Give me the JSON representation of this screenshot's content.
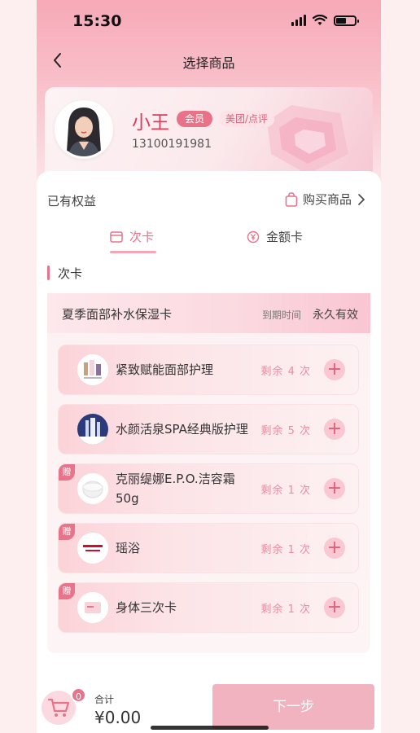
{
  "status_bar": {
    "time": "15:30"
  },
  "header": {
    "title": "选择商品"
  },
  "member": {
    "name": "小王",
    "badge": "会员",
    "source": "美团/点评",
    "phone": "13100191981"
  },
  "panel": {
    "rights_label": "已有权益",
    "buy_label": "购买商品",
    "tabs": [
      {
        "label": "次卡",
        "active": true
      },
      {
        "label": "金额卡",
        "active": false
      }
    ],
    "section_title": "次卡",
    "card": {
      "name": "夏季面部补水保湿卡",
      "expire_label": "到期时间",
      "expire_value": "永久有效"
    },
    "items": [
      {
        "name": "紧致赋能面部护理",
        "remaining": "剩余 4 次",
        "gift": false
      },
      {
        "name": "水颜活泉SPA经典版护理",
        "remaining": "剩余 5 次",
        "gift": false
      },
      {
        "name": "克丽缇娜E.P.O.洁容霜50g",
        "remaining": "剩余 1 次",
        "gift": true,
        "gift_label": "赠"
      },
      {
        "name": "瑶浴",
        "remaining": "剩余 1 次",
        "gift": true,
        "gift_label": "赠"
      },
      {
        "name": "身体三次卡",
        "remaining": "剩余 1 次",
        "gift": true,
        "gift_label": "赠"
      }
    ]
  },
  "footer": {
    "cart_count": "0",
    "total_label": "合计",
    "total_value": "¥0.00",
    "next_label": "下一步"
  },
  "colors": {
    "accent": "#e8738a",
    "brand_pink": "#f7a9b8",
    "button": "#f2b3c0"
  }
}
